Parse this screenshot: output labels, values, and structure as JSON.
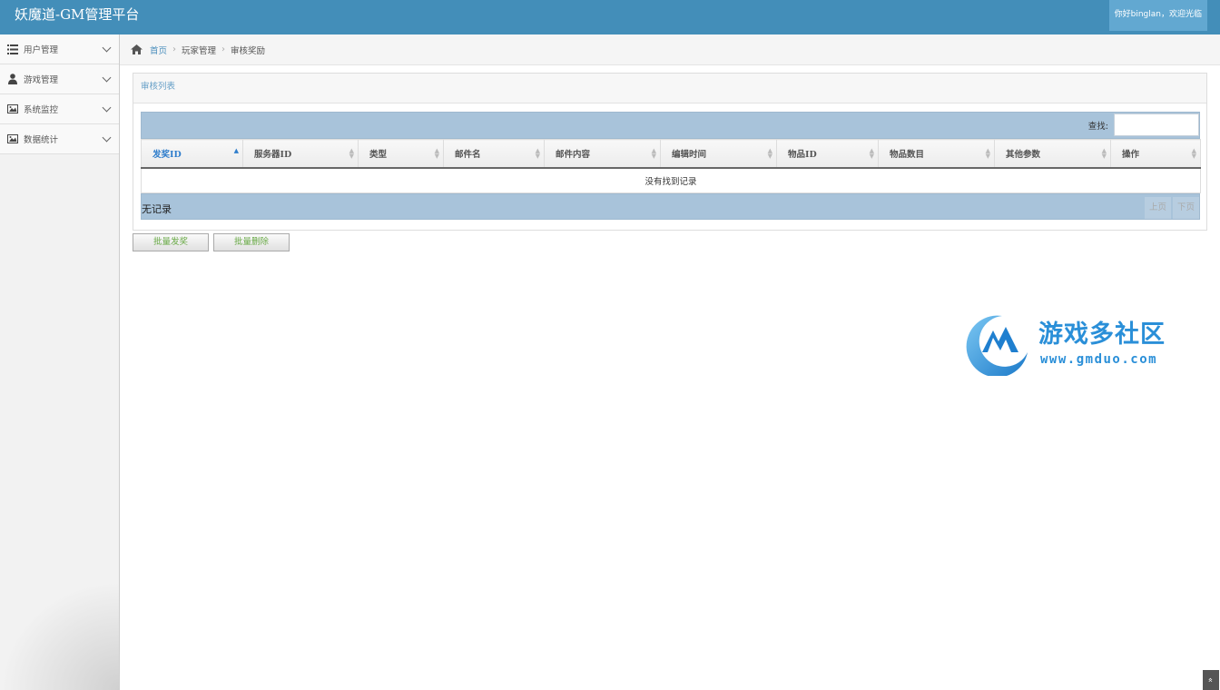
{
  "header": {
    "title": "妖魔道-GM管理平台",
    "user_greeting": "你好binglan，欢迎光临"
  },
  "sidebar": {
    "items": [
      {
        "label": "用户管理",
        "icon": "list-icon"
      },
      {
        "label": "游戏管理",
        "icon": "user-icon"
      },
      {
        "label": "系统监控",
        "icon": "picture-icon"
      },
      {
        "label": "数据统计",
        "icon": "picture-icon"
      }
    ]
  },
  "breadcrumb": {
    "home": "首页",
    "section": "玩家管理",
    "page": "审核奖励"
  },
  "panel": {
    "title": "审核列表"
  },
  "table": {
    "search_label": "查找:",
    "columns": [
      "发奖ID",
      "服务器ID",
      "类型",
      "邮件名",
      "邮件内容",
      "编辑时间",
      "物品ID",
      "物品数目",
      "其他参数",
      "操作"
    ],
    "empty_text": "没有找到记录",
    "footer_info": "无记录",
    "prev_label": "上页",
    "next_label": "下页"
  },
  "actions": {
    "batch_send": "批量发奖",
    "batch_delete": "批量删除"
  },
  "watermark": {
    "title": "游戏多社区",
    "url": "www.gmduo.com"
  },
  "colors": {
    "header": "#438eb9",
    "table_bar": "#a8c3da",
    "link": "#4c8fbd",
    "button_text": "#69aa46"
  }
}
